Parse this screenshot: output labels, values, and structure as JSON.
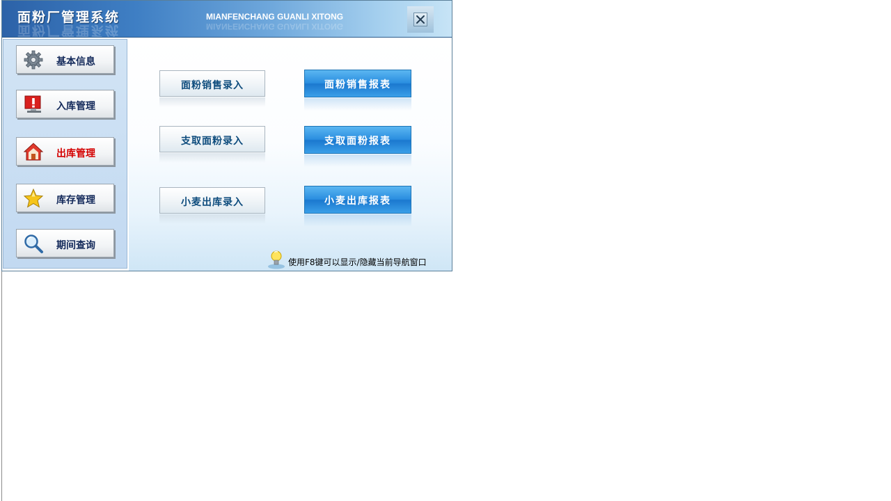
{
  "window": {
    "title": "面粉厂管理系统",
    "subtitle": "MIANFENCHANG GUANLI XITONG"
  },
  "sidebar": {
    "items": [
      {
        "label": "基本信息",
        "icon": "gear-icon"
      },
      {
        "label": "入库管理",
        "icon": "monitor-alert-icon"
      },
      {
        "label": "出库管理",
        "icon": "house-icon",
        "active": true
      },
      {
        "label": "库存管理",
        "icon": "star-icon"
      },
      {
        "label": "期间查询",
        "icon": "magnifier-icon"
      }
    ]
  },
  "main": {
    "entries": [
      {
        "entry": "面粉销售录入",
        "report": "面粉销售报表"
      },
      {
        "entry": "支取面粉录入",
        "report": "支取面粉报表"
      },
      {
        "entry": "小麦出库录入",
        "report": "小麦出库报表"
      }
    ]
  },
  "hint": {
    "text": "使用F8键可以显示/隐藏当前导航窗口",
    "icon": "lightbulb-icon"
  },
  "colors": {
    "active_nav_text": "#d40000",
    "nav_text": "#13295a",
    "report_button": "#2a8ee0",
    "entry_text": "#0e4c7d"
  }
}
